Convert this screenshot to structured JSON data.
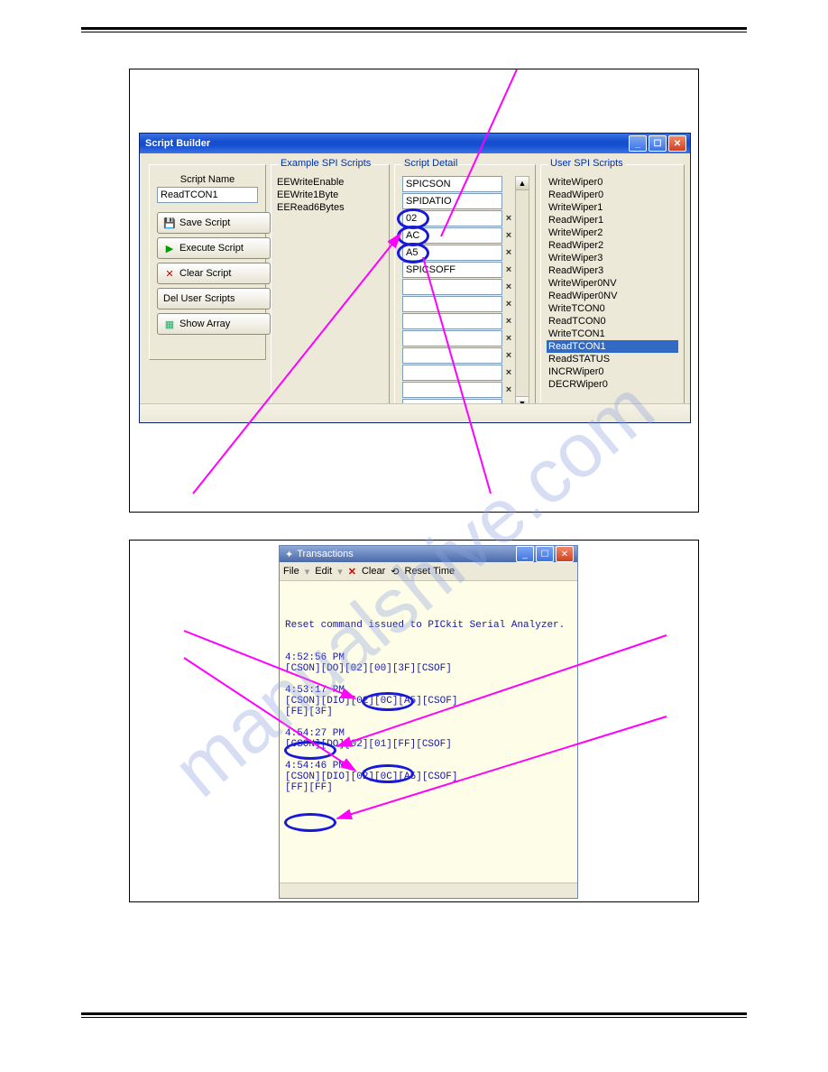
{
  "watermark": "manualshive.com",
  "fig1": {
    "window_title": "Script Builder",
    "legend_example": "Example SPI Scripts",
    "legend_detail": "Script Detail",
    "legend_user": "User SPI Scripts",
    "script_name_label": "Script Name",
    "script_name_value": "ReadTCON1",
    "buttons": {
      "save": "Save Script",
      "execute": "Execute Script",
      "clear": "Clear Script",
      "del": "Del User Scripts",
      "show": "Show Array"
    },
    "example_list": [
      "EEWriteEnable",
      "EEWrite1Byte",
      "EERead6Bytes"
    ],
    "script_detail": [
      "SPICSON",
      "SPIDATIO",
      "02",
      "AC",
      "A5",
      "SPICSOFF",
      "",
      "",
      "",
      "",
      "",
      "",
      "",
      ""
    ],
    "user_list": [
      "WriteWiper0",
      "ReadWiper0",
      "WriteWiper1",
      "ReadWiper1",
      "WriteWiper2",
      "ReadWiper2",
      "WriteWiper3",
      "ReadWiper3",
      "WriteWiper0NV",
      "ReadWiper0NV",
      "WriteTCON0",
      "ReadTCON0",
      "WriteTCON1",
      "ReadTCON1",
      "ReadSTATUS",
      "INCRWiper0",
      "DECRWiper0"
    ],
    "user_list_selected_index": 13
  },
  "fig2": {
    "window_title": "Transactions",
    "menu": {
      "file": "File",
      "edit": "Edit",
      "clear": "Clear",
      "reset": "Reset Time"
    },
    "reset_msg": "Reset command issued to PICkit Serial Analyzer.",
    "groups": [
      {
        "ts": "4:52:56 PM",
        "line": "[CSON][DO][02][00][3F][CSOF]",
        "extra": ""
      },
      {
        "ts": "4:53:17 PM",
        "line": "[CSON][DIO][02][0C][A5][CSOF]",
        "extra": "[FE][3F]"
      },
      {
        "ts": "4:54:27 PM",
        "line": "[CSON][DO][02][01][FF][CSOF]",
        "extra": ""
      },
      {
        "ts": "4:54:46 PM",
        "line": "[CSON][DIO][02][0C][A5][CSOF]",
        "extra": "[FF][FF]"
      }
    ]
  }
}
